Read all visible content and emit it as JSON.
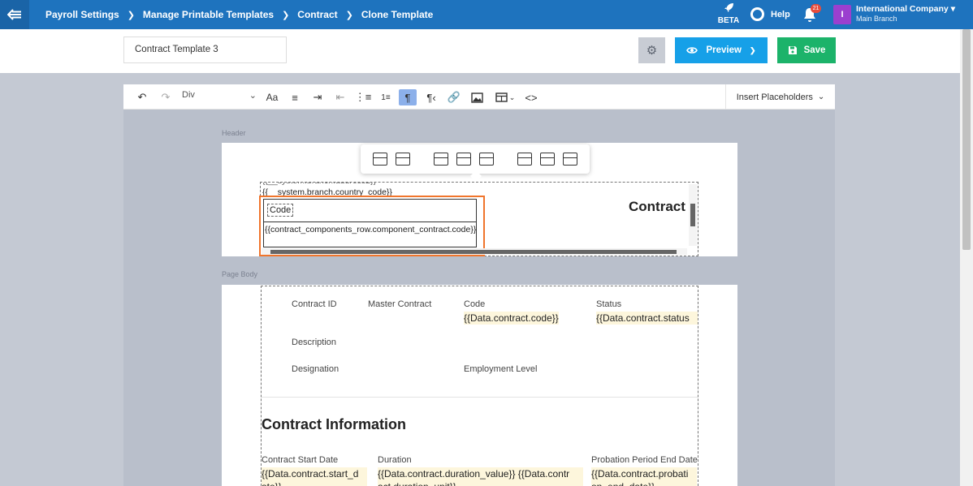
{
  "breadcrumbs": [
    "Payroll Settings",
    "Manage Printable Templates",
    "Contract",
    "Clone Template"
  ],
  "topbar": {
    "beta_label": "BETA",
    "help_label": "Help",
    "notifications_count": "21",
    "company_initial": "I",
    "company_name": "International Company",
    "branch_name": "Main Branch"
  },
  "header": {
    "template_name": "Contract Template 3",
    "preview_label": "Preview",
    "save_label": "Save"
  },
  "toolbar": {
    "block_format": "Div",
    "insert_placeholders_label": "Insert Placeholders"
  },
  "regions": {
    "header_label": "Header",
    "body_label": "Page Body"
  },
  "header_content": {
    "line1": "{{__system.branch.country_code}}",
    "code_label": "Code",
    "code_placeholder": "{{contract_components_row.component_contract.code}}",
    "contract_title": "Contract"
  },
  "body_content": {
    "contract_id_label": "Contract ID",
    "master_contract_label": "Master Contract",
    "code_label": "Code",
    "code_value": "{{Data.contract.code}}",
    "status_label": "Status",
    "status_value": "{{Data.contract.status",
    "description_label": "Description",
    "designation_label": "Designation",
    "employment_level_label": "Employment Level",
    "section_title": "Contract Information",
    "start_date_label": "Contract Start Date",
    "start_date_value": "{{Data.contract.start_d ate}}",
    "duration_label": "Duration",
    "duration_value": "{{Data.contract.duration_value}} {{Data.contr act.duration_unit}}",
    "probation_label": "Probation Period End Date",
    "probation_value": "{{Data.contract.probati on_end_date}}"
  },
  "colors": {
    "topbar": "#1e73be",
    "preview": "#16a0e8",
    "save": "#1cb36a",
    "selection": "#f0752c"
  }
}
